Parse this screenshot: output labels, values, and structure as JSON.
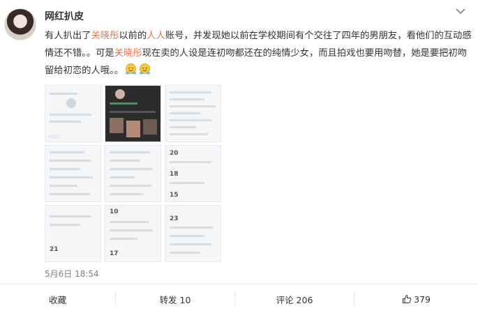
{
  "post": {
    "username": "网红扒皮",
    "text_parts": [
      "有人扒出了",
      "关晓彤",
      "以前的",
      "人人",
      "账号，并发现她以前在学校期间有个交往了四年的男朋友，看他们的互动感情还不错。。可是",
      "关晓彤",
      "现在卖的人设是连初吻都还在的纯情少女，而且拍戏也要用吻替，她是要把初吻留给初恋的人哦。。"
    ],
    "emoji_icons": [
      "hug-emoji-icon",
      "hug-emoji-icon"
    ],
    "date": "5月6日 18:54",
    "image_count": 9
  },
  "thumbnails": {
    "numbers": [
      "20",
      "18",
      "15",
      "10",
      "21",
      "23",
      "17"
    ]
  },
  "actions": {
    "favorite_label": "收藏",
    "repost_label": "转发 10",
    "comment_label": "评论 206",
    "like_label": "379"
  },
  "colors": {
    "highlight": "#eb7350",
    "text": "#333333",
    "muted": "#808080",
    "divider": "#e6e6e6"
  }
}
